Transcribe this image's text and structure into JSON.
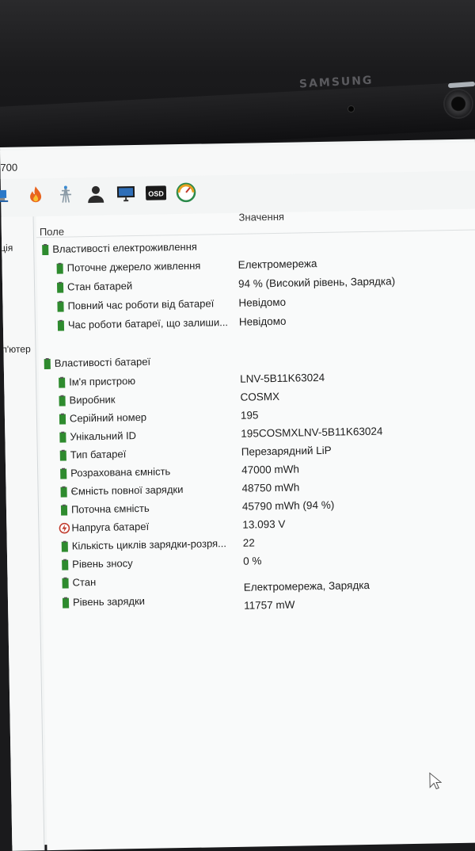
{
  "bezel": {
    "brand": "SAMSUNG"
  },
  "window": {
    "title_fragment": "700"
  },
  "toolbar": {
    "icons": [
      "network-icon",
      "flame-icon",
      "tower-icon",
      "user-icon",
      "monitor-icon",
      "osd-icon",
      "gauge-icon"
    ],
    "osd_label": "OSD"
  },
  "left_pane": {
    "item_1": "ція",
    "item_2": "п'ютер"
  },
  "columns": {
    "field": "Поле",
    "value": "Значення"
  },
  "power_section": {
    "title": "Властивості електроживлення",
    "rows": [
      {
        "label": "Поточне джерело живлення",
        "value": "Електромережа"
      },
      {
        "label": "Стан батарей",
        "value": "94 % (Високий рівень, Зарядка)"
      },
      {
        "label": "Повний час роботи від батареї",
        "value": "Невідомо"
      },
      {
        "label": "Час роботи батареї, що залиши...",
        "value": "Невідомо"
      }
    ]
  },
  "battery_section": {
    "title": "Властивості батареї",
    "rows": [
      {
        "label": "Ім'я пристрою",
        "value": "LNV-5B11K63024"
      },
      {
        "label": "Виробник",
        "value": "COSMX"
      },
      {
        "label": "Серійний номер",
        "value": "195"
      },
      {
        "label": "Унікальний ID",
        "value": "195COSMXLNV-5B11K63024"
      },
      {
        "label": "Тип батареї",
        "value": "Перезарядний LiP"
      },
      {
        "label": "Розрахована ємність",
        "value": "47000 mWh"
      },
      {
        "label": "Ємність повної зарядки",
        "value": "48750 mWh"
      },
      {
        "label": "Поточна ємність",
        "value": "45790 mWh  (94 %)"
      },
      {
        "label": "Напруга батареї",
        "value": "13.093 V"
      },
      {
        "label": "Кількість циклів зарядки-розря...",
        "value": "22"
      },
      {
        "label": "Рівень зносу",
        "value": "0 %"
      },
      {
        "label": "Стан",
        "value": "Електромережа, Зарядка"
      },
      {
        "label": "Рівень зарядки",
        "value": "11757 mW"
      }
    ]
  },
  "colors": {
    "battery_icon": "#2e8b2e",
    "voltage_icon": "#c0392b",
    "screen_bg": "#f3f5f5"
  }
}
